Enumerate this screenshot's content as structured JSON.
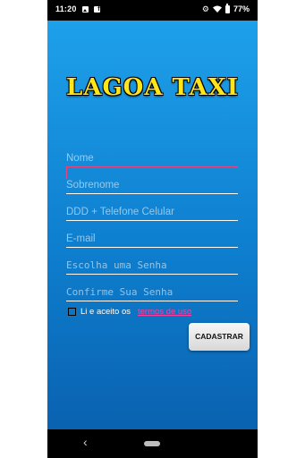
{
  "status_bar": {
    "time": "11:20",
    "battery_percent": "77%",
    "icons": [
      "image-notification-icon",
      "facebook-icon",
      "gear-icon",
      "wifi-icon",
      "battery-icon"
    ]
  },
  "app": {
    "title": "LAGOA TAXI",
    "colors": {
      "background_top": "#1ea0ea",
      "background_bottom": "#0a62b0",
      "title": "#ffe51a",
      "accent": "#e6457f",
      "link": "#ff3da0"
    }
  },
  "form": {
    "nome_placeholder": "Nome",
    "sobrenome_placeholder": "Sobrenome",
    "telefone_placeholder": "DDD + Telefone Celular",
    "email_placeholder": "E-mail",
    "senha_placeholder": "Escolha uma Senha",
    "confirmar_senha_placeholder": "Confirme Sua Senha",
    "terms_text": "Li e aceito os",
    "terms_link": "termos de uso",
    "terms_checked": false,
    "submit_label": "CADASTRAR"
  },
  "navigation": {
    "back_icon": "chevron-left-icon",
    "home_icon": "home-pill-icon"
  }
}
